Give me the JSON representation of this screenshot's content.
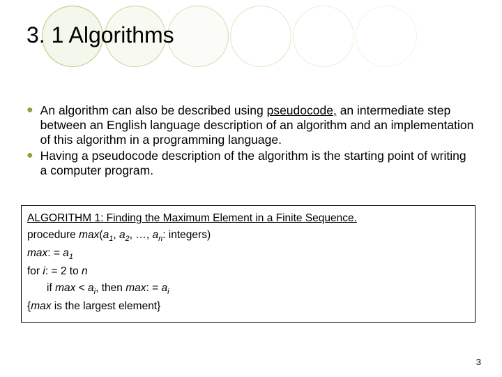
{
  "title": "3. 1 Algorithms",
  "bullets": {
    "b1_pre": "An algorithm can also be described using ",
    "b1_u": "pseudocode,",
    "b1_post": " an intermediate step between an English language description of an algorithm and an implementation of this algorithm in a programming language.",
    "b2": " Having a pseudocode description of the algorithm is the starting point of writing a computer program."
  },
  "algo": {
    "heading": "ALGORITHM 1: Finding the Maximum Element in a Finite Sequence.",
    "l1_a": "procedure ",
    "l1_b": "max",
    "l1_c": "(",
    "l1_d": "a",
    "l1_s1": "1",
    "l1_e": ", ",
    "l1_f": "a",
    "l1_s2": "2",
    "l1_g": ", …, ",
    "l1_h": "a",
    "l1_sn": "n",
    "l1_i": ": integers)",
    "l2_a": "max",
    "l2_b": ": = ",
    "l2_c": "a",
    "l2_s1": "1",
    "l3_a": "for ",
    "l3_b": "i",
    "l3_c": ": = 2 to ",
    "l3_d": "n",
    "l4_a": "if ",
    "l4_b": "max",
    "l4_c": " < ",
    "l4_d": "a",
    "l4_si": "i",
    "l4_e": ", then ",
    "l4_f": "max",
    "l4_g": ": = ",
    "l4_h": "a",
    "l4_si2": "i",
    "l5_a": "{",
    "l5_b": "max",
    "l5_c": " is the largest element}"
  },
  "pageNumber": "3"
}
